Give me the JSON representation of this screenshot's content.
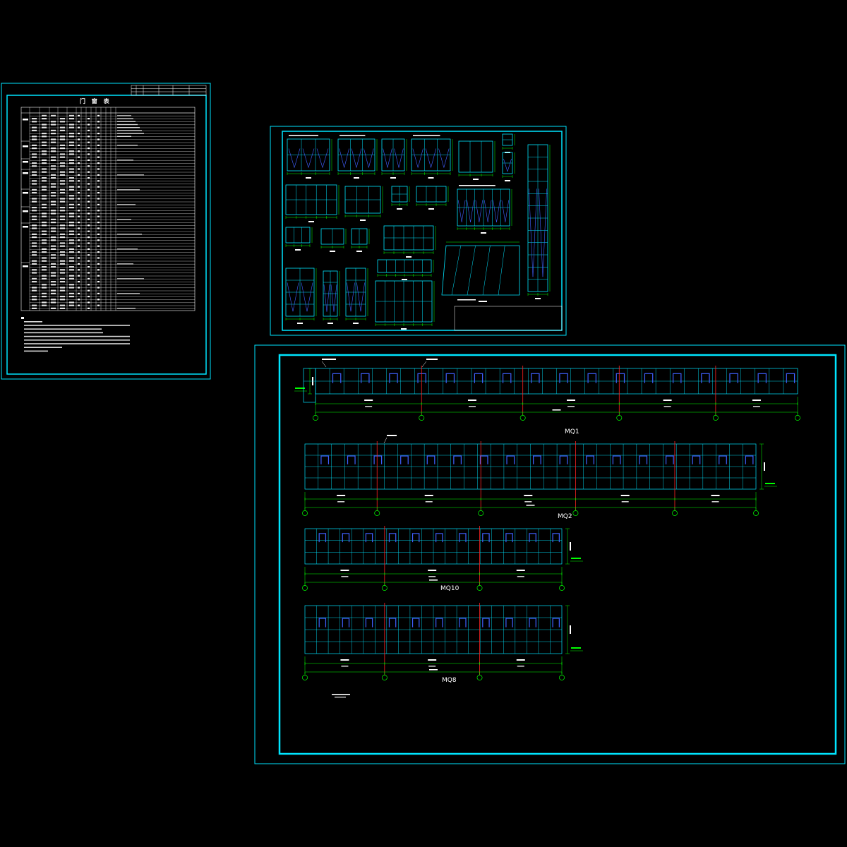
{
  "sheets": {
    "schedule": {
      "title": "门 窗 表"
    },
    "details": {},
    "elevations": {
      "rows": [
        {
          "label": "MQ1",
          "bays": 34
        },
        {
          "label": "MQ2",
          "bays": 34
        },
        {
          "label": "MQ10",
          "bays": 22
        },
        {
          "label": "MQ8",
          "bays": 22
        }
      ]
    }
  },
  "colors": {
    "background": "#000000",
    "frame": "#00e5ff",
    "line_green": "#00ff00",
    "line_red": "#ff2020",
    "line_blue": "#4060ff",
    "text": "#ffffff"
  }
}
